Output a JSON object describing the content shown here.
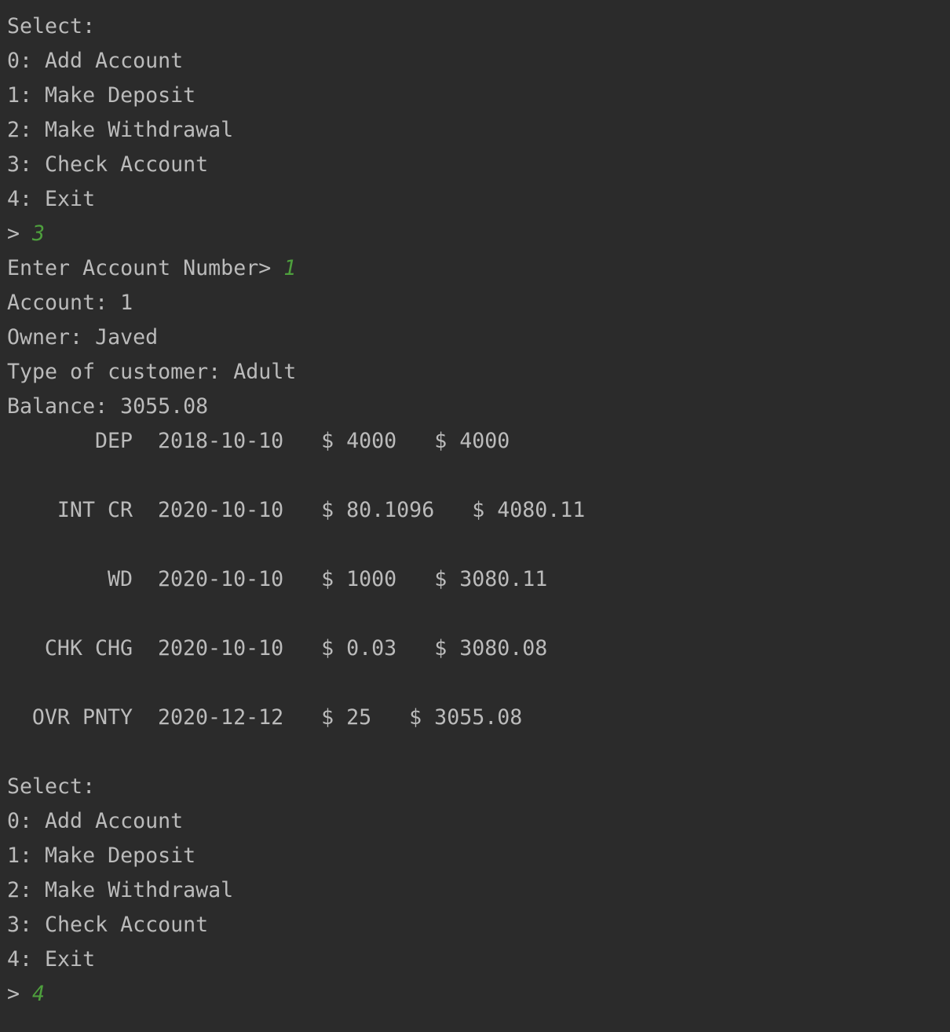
{
  "theme": {
    "background": "#2b2b2b",
    "text": "#bbbbbb",
    "user_input": "#4e9f3d"
  },
  "menu1": {
    "title": "Select:",
    "options": [
      "0: Add Account",
      "1: Make Deposit",
      "2: Make Withdrawal",
      "3: Check Account",
      "4: Exit"
    ],
    "prompt": "> ",
    "input": "3"
  },
  "account_prompt": {
    "label": "Enter Account Number> ",
    "input": "1"
  },
  "account": {
    "number_line": "Account: 1",
    "owner_line": "Owner: Javed",
    "type_line": "Type of customer: Adult",
    "balance_line": "Balance: 3055.08"
  },
  "transactions": [
    {
      "type": "DEP",
      "date": "2018-10-10",
      "amount": "$ 4000",
      "balance": "$ 4000"
    },
    {
      "type": "INT CR",
      "date": "2020-10-10",
      "amount": "$ 80.1096",
      "balance": "$ 4080.11"
    },
    {
      "type": "WD",
      "date": "2020-10-10",
      "amount": "$ 1000",
      "balance": "$ 3080.11"
    },
    {
      "type": "CHK CHG",
      "date": "2020-10-10",
      "amount": "$ 0.03",
      "balance": "$ 3080.08"
    },
    {
      "type": "OVR PNTY",
      "date": "2020-12-12",
      "amount": "$ 25",
      "balance": "$ 3055.08"
    }
  ],
  "menu2": {
    "title": "Select:",
    "options": [
      "0: Add Account",
      "1: Make Deposit",
      "2: Make Withdrawal",
      "3: Check Account",
      "4: Exit"
    ],
    "prompt": "> ",
    "input": "4"
  }
}
